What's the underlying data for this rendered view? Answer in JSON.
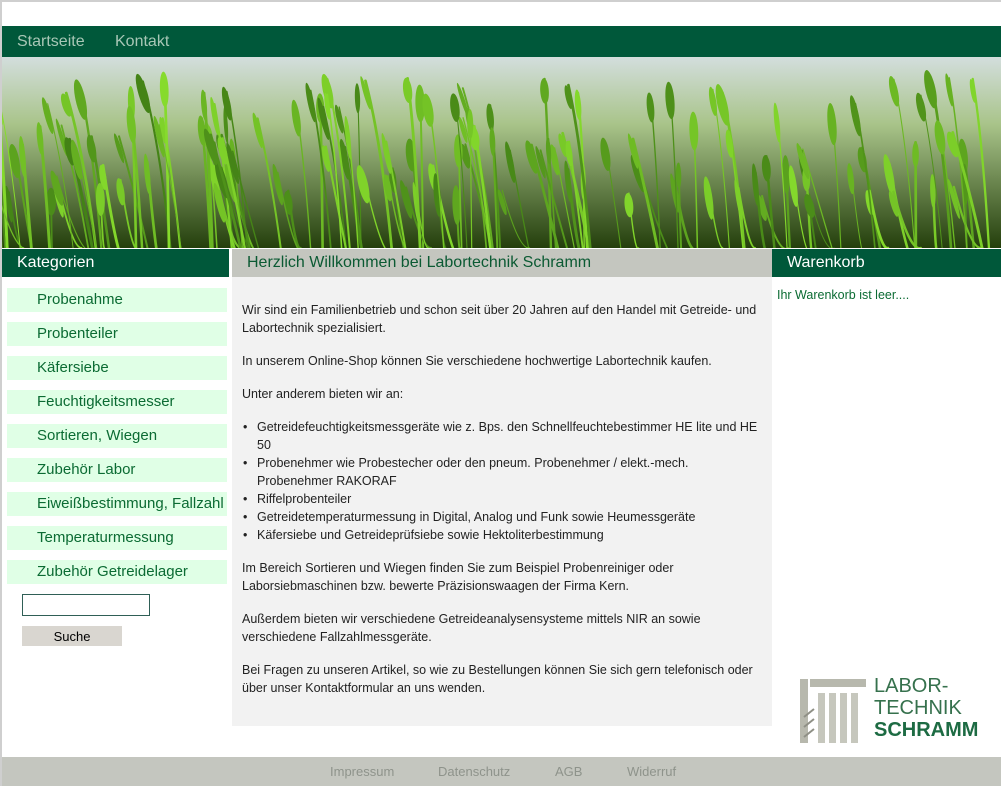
{
  "nav": {
    "items": [
      {
        "label": "Startseite"
      },
      {
        "label": "Kontakt"
      }
    ]
  },
  "sidebar": {
    "title": "Kategorien",
    "items": [
      {
        "label": "Probenahme"
      },
      {
        "label": "Probenteiler"
      },
      {
        "label": "Käfersiebe"
      },
      {
        "label": "Feuchtigkeitsmesser"
      },
      {
        "label": "Sortieren, Wiegen"
      },
      {
        "label": "Zubehör Labor"
      },
      {
        "label": "Eiweißbestimmung, Fallzahl"
      },
      {
        "label": "Temperaturmessung"
      },
      {
        "label": "Zubehör Getreidelager"
      }
    ],
    "search": {
      "value": "",
      "button": "Suche"
    }
  },
  "main": {
    "title": "Herzlich Willkommen bei Labortechnik Schramm",
    "intro": "Wir sind ein Familienbetrieb und schon seit über 20 Jahren auf den Handel mit Getreide- und Labortechnik spezialisiert.",
    "shop": "In unserem Online-Shop können Sie verschiedene hochwertige Labortechnik kaufen.",
    "offer_lead": "Unter anderem bieten wir an:",
    "offers": [
      "Getreidefeuchtigkeitsmessgeräte wie z. Bps. den Schnellfeuchtebestimmer HE lite und HE 50",
      "Probenehmer wie Probestecher oder den pneum. Probenehmer / elekt.-mech. Probenehmer RAKORAF",
      "Riffelprobenteiler",
      "Getreidetemperaturmessung in Digital, Analog und Funk sowie Heumessgeräte",
      "Käfersiebe und Getreideprüfsiebe sowie Hektoliterbestimmung"
    ],
    "sorting": "Im Bereich Sortieren und Wiegen finden Sie zum Beispiel Probenreiniger oder Laborsiebmaschinen bzw. bewerte Präzisionswaagen der Firma Kern.",
    "nir": "Außerdem bieten wir verschiedene Getreideanalysensysteme mittels NIR an sowie verschiedene Fallzahlmessgeräte.",
    "contact": "Bei Fragen zu unseren Artikel, so wie zu Bestellungen können Sie sich gern telefonisch oder über unser Kontaktformular an uns wenden."
  },
  "cart": {
    "title": "Warenkorb",
    "empty": "Ihr Warenkorb ist leer...."
  },
  "logo": {
    "line1": "LABOR-",
    "line2": "TECHNIK",
    "line3": "SCHRAMM"
  },
  "footer": {
    "links": [
      {
        "label": "Impressum"
      },
      {
        "label": "Datenschutz"
      },
      {
        "label": "AGB"
      },
      {
        "label": "Widerruf"
      }
    ]
  },
  "colors": {
    "brand_green": "#00583a",
    "category_bg": "#e0ffe6",
    "panel_gray": "#c4c6bf"
  }
}
